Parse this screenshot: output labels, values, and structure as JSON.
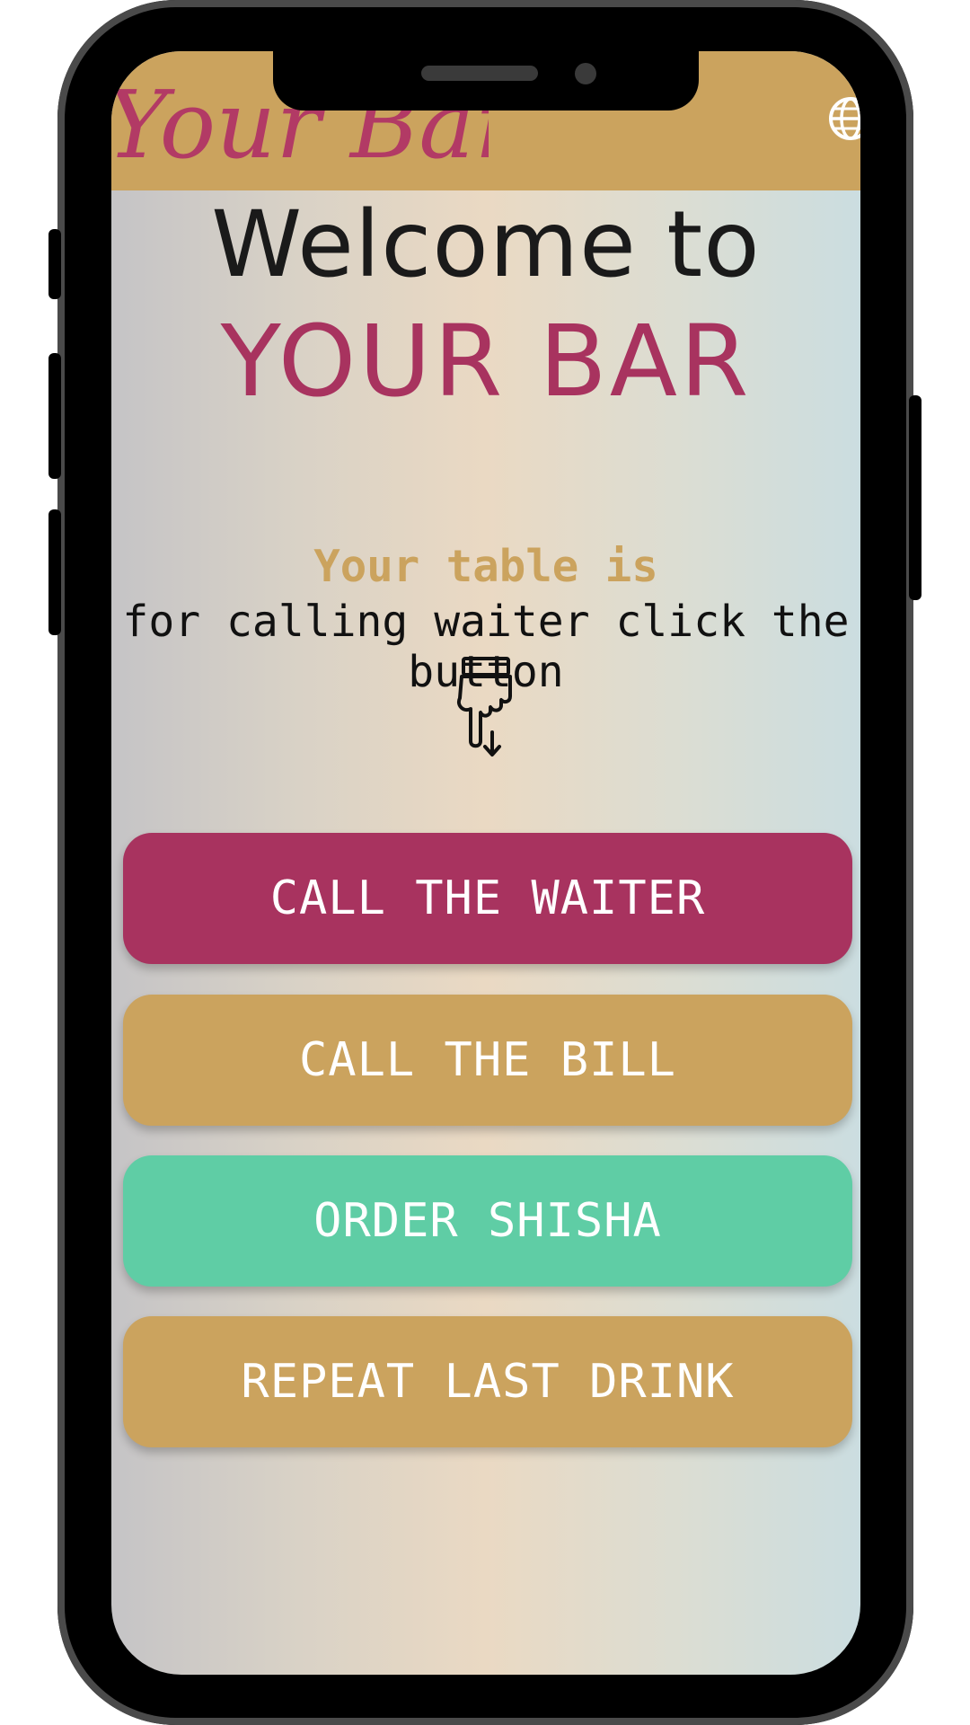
{
  "app": {
    "logo_text": "Your Bar",
    "accent_color": "#cba35e",
    "brand_color": "#a8335f",
    "shisha_color": "#5fcda5"
  },
  "hero": {
    "welcome_line": "Welcome to",
    "bar_name": "YOUR BAR"
  },
  "info": {
    "table_label": "Your table is",
    "instruction_line1": "for calling waiter click the",
    "instruction_line2": "button"
  },
  "icons": {
    "language": "globe-icon",
    "pointer": "pointing-hand-down-icon"
  },
  "actions": [
    {
      "label": "CALL THE WAITER",
      "color": "#a8335f"
    },
    {
      "label": "CALL THE BILL",
      "color": "#cba35e"
    },
    {
      "label": "ORDER SHISHA",
      "color": "#5fcda5"
    },
    {
      "label": "REPEAT LAST DRINK",
      "color": "#cba35e"
    }
  ]
}
